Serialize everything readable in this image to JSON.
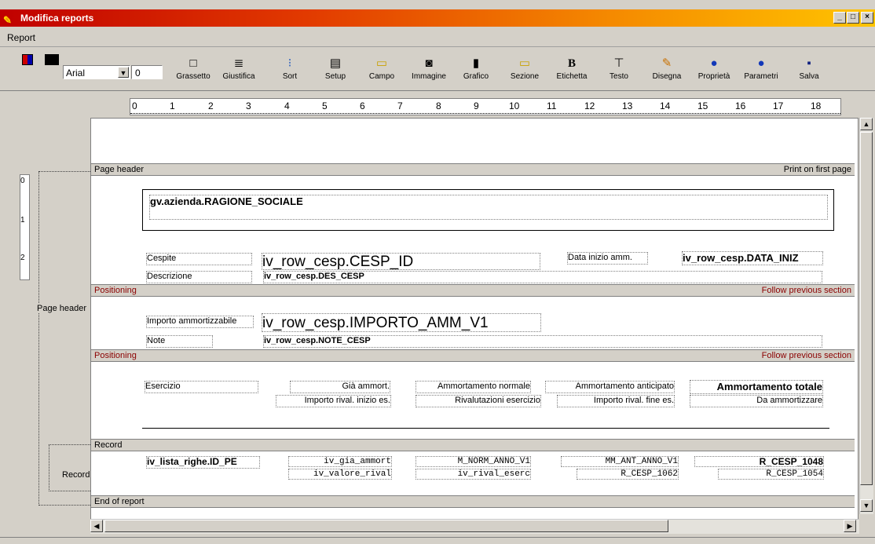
{
  "window": {
    "title": "Modifica reports",
    "min": "_",
    "max": "□",
    "close": "×"
  },
  "menu": {
    "report": "Report"
  },
  "toolbar": {
    "font": "Arial",
    "size": "0",
    "buttons": [
      {
        "label": "Grassetto",
        "icon": "□"
      },
      {
        "label": "Giustifica",
        "icon": "≣"
      },
      {
        "label": "Sort",
        "icon": "⁝"
      },
      {
        "label": "Setup",
        "icon": "▤"
      },
      {
        "label": "Campo",
        "icon": "▭"
      },
      {
        "label": "Immagine",
        "icon": "◙"
      },
      {
        "label": "Grafico",
        "icon": "▮"
      },
      {
        "label": "Sezione",
        "icon": "▭"
      },
      {
        "label": "Etichetta",
        "icon": "B"
      },
      {
        "label": "Testo",
        "icon": "⊤"
      },
      {
        "label": "Disegna",
        "icon": "✎"
      },
      {
        "label": "Proprietà",
        "icon": "●"
      },
      {
        "label": "Parametri",
        "icon": "●"
      },
      {
        "label": "Salva",
        "icon": "▪"
      }
    ]
  },
  "ruler": {
    "marks": [
      "0",
      "1",
      "2",
      "3",
      "4",
      "5",
      "6",
      "7",
      "8",
      "9",
      "10",
      "11",
      "12",
      "13",
      "14",
      "15",
      "16",
      "17",
      "18"
    ]
  },
  "vruler": {
    "marks": [
      "0",
      "1",
      "2"
    ]
  },
  "left_labels": {
    "page_header": "Page header",
    "record": "Record"
  },
  "bands": {
    "page_header": "Page header",
    "print_first": "Print on first page",
    "positioning1": "Positioning",
    "follow1": "Follow previous section",
    "positioning2": "Positioning",
    "follow2": "Follow previous section",
    "record": "Record",
    "end": "End of report"
  },
  "fields": {
    "azienda": "gv.azienda.RAGIONE_SOCIALE",
    "cespite_lbl": "Cespite",
    "cesp_id": "iv_row_cesp.CESP_ID",
    "data_inizio_lbl": "Data inizio amm.",
    "data_iniz": "iv_row_cesp.DATA_INIZ",
    "descrizione_lbl": "Descrizione",
    "des_cesp": "iv_row_cesp.DES_CESP",
    "importo_lbl": "Importo ammortizzabile",
    "importo_amm": "iv_row_cesp.IMPORTO_AMM_V1",
    "note_lbl": "Note",
    "note_cesp": "iv_row_cesp.NOTE_CESP",
    "esercizio": "Esercizio",
    "gia_ammort": "Già ammort.",
    "amm_normale": "Ammortamento normale",
    "amm_anticipato": "Ammortamento anticipato",
    "amm_totale": "Ammortamento totale",
    "importo_rival_inizio": "Importo rival. inizio es.",
    "rivalutazioni": "Rivalutazioni esercizio",
    "importo_rival_fine": "Importo rival. fine es.",
    "da_ammortizzare": "Da ammortizzare",
    "id_pe": "iv_lista_righe.ID_PE",
    "iv_gia_ammort": "iv_gia_ammort",
    "m_norm": "M_NORM_ANNO_V1",
    "mm_ant": "MM_ANT_ANNO_V1",
    "r_cesp_1048": "R_CESP_1048",
    "iv_valore_rival": "iv_valore_rival",
    "iv_rival_eserc": "iv_rival_eserc",
    "r_cesp_1062": "R_CESP_1062",
    "r_cesp_1054": "R_CESP_1054"
  }
}
